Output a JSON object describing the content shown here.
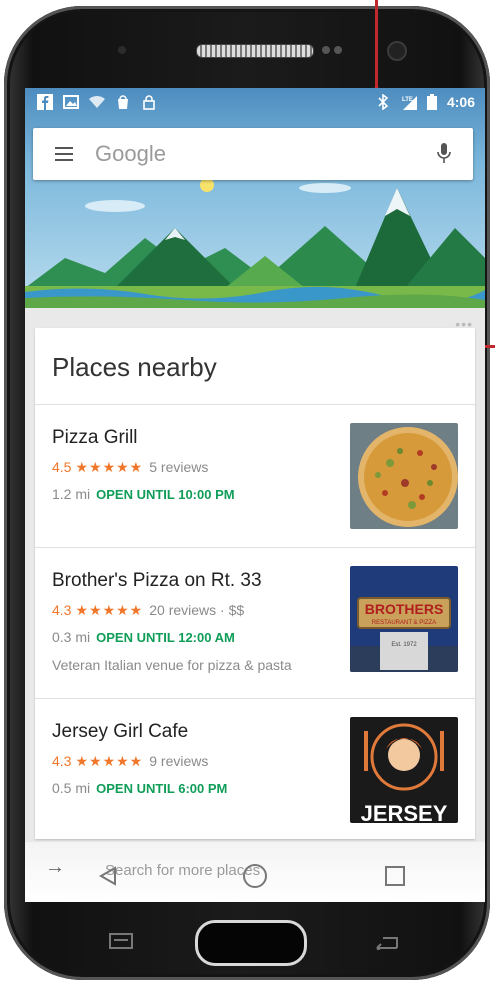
{
  "status_bar": {
    "time": "4:06",
    "left_icons": [
      "facebook-icon",
      "image-icon",
      "wifi-icon",
      "shopping-bag-icon",
      "lock-icon"
    ],
    "right_icons": [
      "bluetooth-icon",
      "lte-signal-icon",
      "battery-icon"
    ],
    "lte_label": "LTE"
  },
  "search": {
    "placeholder": "Google",
    "menu_icon": "menu-icon",
    "mic_icon": "mic-icon"
  },
  "card": {
    "title": "Places nearby",
    "places": [
      {
        "name": "Pizza Grill",
        "rating": "4.5",
        "stars": "★★★★★",
        "reviews": "5 reviews",
        "distance": "1.2 mi",
        "hours": "OPEN UNTIL 10:00 PM",
        "description": ""
      },
      {
        "name": "Brother's Pizza on Rt. 33",
        "rating": "4.3",
        "stars": "★★★★★",
        "reviews": "20 reviews · $$",
        "distance": "0.3 mi",
        "hours": "OPEN UNTIL 12:00 AM",
        "description": "Veteran Italian venue for pizza & pasta"
      },
      {
        "name": "Jersey Girl Cafe",
        "rating": "4.3",
        "stars": "★★★★★",
        "reviews": "9 reviews",
        "distance": "0.5 mi",
        "hours": "OPEN UNTIL 6:00 PM",
        "description": ""
      }
    ]
  },
  "thumbs": {
    "brothers_sign": "BROTHERS",
    "brothers_sub": "RESTAURANT & PIZZA",
    "brothers_est": "Est. 1972",
    "jersey_logo": "JERSEY"
  },
  "more": {
    "label": "Search for more places"
  },
  "colors": {
    "accent_orange": "#f0772a",
    "open_green": "#0f9d58",
    "callout_red": "#c0282d"
  }
}
